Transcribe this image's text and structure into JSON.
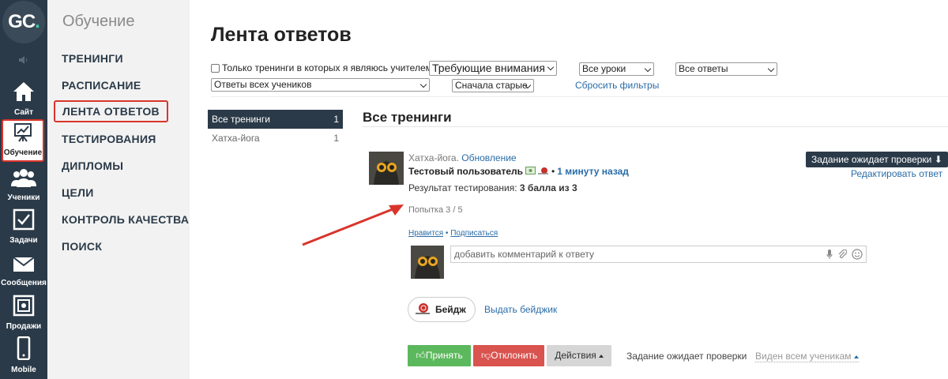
{
  "logo": {
    "text": "GC",
    "dot": "."
  },
  "rail": {
    "items": [
      {
        "label": "Сайт",
        "icon": "home-icon"
      },
      {
        "label": "Обучение",
        "icon": "chart-board-icon",
        "active": true
      },
      {
        "label": "Ученики",
        "icon": "users-icon"
      },
      {
        "label": "Задачи",
        "icon": "checkbox-icon"
      },
      {
        "label": "Сообщения",
        "icon": "envelope-icon"
      },
      {
        "label": "Продажи",
        "icon": "safe-icon"
      },
      {
        "label": "Mobile",
        "icon": "phone-icon"
      }
    ]
  },
  "menu": {
    "title": "Обучение",
    "items": [
      "ТРЕНИНГИ",
      "РАСПИСАНИЕ",
      "ЛЕНТА ОТВЕТОВ",
      "ТЕСТИРОВАНИЯ",
      "ДИПЛОМЫ",
      "ЦЕЛИ",
      "КОНТРОЛЬ КАЧЕСТВА",
      "ПОИСК"
    ],
    "active": "ЛЕНТА ОТВЕТОВ"
  },
  "page": {
    "title": "Лента ответов"
  },
  "filters": {
    "teacher_only_label": "Только тренинги в которых я являюсь учителем",
    "teacher_only_checked": false,
    "status": "Требующие внимания",
    "lessons": "Все уроки",
    "answers": "Все ответы",
    "students": "Ответы всех учеников",
    "order": "Сначала старые",
    "reset": "Сбросить фильтры"
  },
  "trainings": [
    {
      "name": "Все тренинги",
      "count": "1",
      "selected": true
    },
    {
      "name": "Хатха-йога",
      "count": "1",
      "selected": false
    }
  ],
  "content": {
    "section_title": "Все тренинги",
    "entry": {
      "training": "Хатха-йога.",
      "lesson": "Обновление",
      "user": "Тестовый пользователь",
      "bullet": "•",
      "time": "1 минуту назад",
      "result_label": "Результат тестирования:",
      "result_value": "3 балла из 3",
      "attempt": "Попытка 3 / 5",
      "await_button": "Задание ожидает проверки",
      "edit": "Редактировать ответ",
      "like": "Нравится",
      "like_sep": "•",
      "subscribe": "Подписаться",
      "comment_placeholder": "добавить комментарий к ответу",
      "badge_label": "Бейдж",
      "give_badge": "Выдать бейджик",
      "accept": "Принять",
      "reject": "Отклонить",
      "actions": "Действия",
      "status": "Задание ожидает проверки",
      "visibility": "Виден всем ученикам"
    }
  },
  "colors": {
    "rail": "#2b3a48",
    "accent_red": "#d9342b",
    "link": "#2a6ca7",
    "accept": "#5cb85c",
    "reject": "#d9534f"
  }
}
